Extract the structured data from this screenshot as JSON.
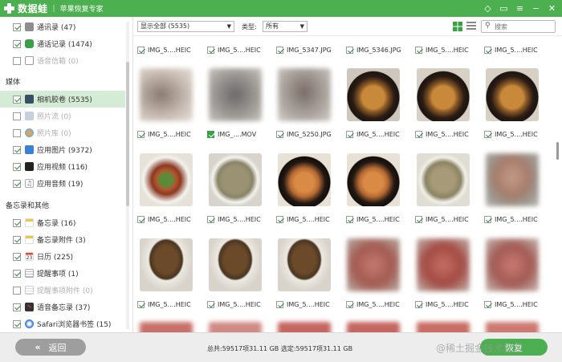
{
  "app": {
    "name": "数据蛙",
    "subtitle": "苹果恢复专家"
  },
  "titlebar_icons": [
    "diamond-icon",
    "chat-icon",
    "menu-icon",
    "minimize-icon",
    "close-icon"
  ],
  "sidebar": {
    "items": [
      {
        "label": "通讯录 (47)",
        "checked": true,
        "icon_color": "#8d8d8d",
        "dim": false
      },
      {
        "label": "通话记录 (1474)",
        "checked": true,
        "icon_color": "#3aa047",
        "dim": false
      },
      {
        "label": "语音信箱 (0)",
        "checked": false,
        "icon_color": "#9a9a9a",
        "dim": true
      }
    ],
    "section_media": "媒体",
    "media_items": [
      {
        "label": "相机胶卷 (5535)",
        "checked": true,
        "icon_color": "#3a4d66",
        "dim": false,
        "selected": true
      },
      {
        "label": "照片流 (0)",
        "checked": false,
        "icon_color": "#9aa8b8",
        "dim": true
      },
      {
        "label": "照片库 (0)",
        "checked": false,
        "icon_color": "#d57d3a",
        "dim": true
      },
      {
        "label": "应用图片 (9372)",
        "checked": true,
        "icon_color": "#3b7fd6",
        "dim": false
      },
      {
        "label": "应用视频 (116)",
        "checked": true,
        "icon_color": "#222222",
        "dim": false
      },
      {
        "label": "应用音频 (19)",
        "checked": true,
        "icon_color": "#b0b0b0",
        "dim": false
      }
    ],
    "section_memo": "备忘录和其他",
    "memo_items": [
      {
        "label": "备忘录 (16)",
        "checked": true,
        "icon_color": "#f2c446",
        "dim": false
      },
      {
        "label": "备忘录附件 (3)",
        "checked": true,
        "icon_color": "#f2c446",
        "dim": false
      },
      {
        "label": "日历 (225)",
        "checked": true,
        "icon_color": "#d84a3a",
        "dim": false
      },
      {
        "label": "提醒事项 (1)",
        "checked": true,
        "icon_color": "#aaaaaa",
        "dim": false
      },
      {
        "label": "提醒事项附件 (0)",
        "checked": false,
        "icon_color": "#aaaaaa",
        "dim": true
      },
      {
        "label": "语音备忘录 (37)",
        "checked": true,
        "icon_color": "#333333",
        "dim": false
      },
      {
        "label": "Safari浏览器书签 (15)",
        "checked": true,
        "icon_color": "#3b7fd6",
        "dim": false
      }
    ]
  },
  "filter": {
    "show_value": "显示全部 (5535)",
    "type_label": "类型:",
    "type_value": "所有",
    "search_placeholder": "搜索"
  },
  "grid": {
    "row1_labels": [
      "IMG_5....HEIC",
      "IMG_5....HEIC",
      "IMG_5347.JPG",
      "IMG_5346.JPG",
      "IMG_5....HEIC",
      "IMG_5....HEIC"
    ],
    "row2_labels": [
      "IMG_5....HEIC",
      "IMG_....MOV",
      "IMG_5250.JPG",
      "IMG_5....HEIC",
      "IMG_5....HEIC",
      "IMG_5....HEIC"
    ],
    "row3_labels": [
      "IMG_5....HEIC",
      "IMG_5....HEIC",
      "IMG_5....HEIC",
      "IMG_5....HEIC",
      "IMG_5....HEIC",
      "IMG_5....HEIC"
    ],
    "row4_labels": [
      "IMG_5....HEIC",
      "IMG_5....HEIC",
      "IMG_5....HEIC",
      "IMG_5....HEIC",
      "IMG_5....HEIC",
      "IMG_5....HEIC"
    ]
  },
  "footer": {
    "back_label": "返回",
    "summary": "总共:59517项31.11 GB 选定:59517项31.11 GB",
    "recover_label": "恢复",
    "watermark": "@稀土掘金技术社区"
  }
}
